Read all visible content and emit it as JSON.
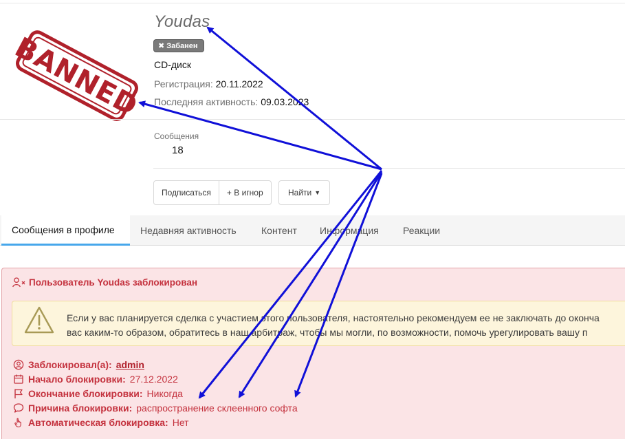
{
  "profile": {
    "username": "Youdas",
    "badge": "Забанен",
    "user_title": "CD-диск",
    "registration_label": "Регистрация:",
    "registration_value": "20.11.2022",
    "last_activity_label": "Последняя активность:",
    "last_activity_value": "09.03.2023",
    "stamp_text": "BANNED"
  },
  "stats": {
    "messages_label": "Сообщения",
    "messages_value": "18"
  },
  "actions": {
    "follow": "Подписаться",
    "ignore": "+ В игнор",
    "find": "Найти"
  },
  "tabs": [
    {
      "label": "Сообщения в профиле",
      "active": true
    },
    {
      "label": "Недавняя активность",
      "active": false
    },
    {
      "label": "Контент",
      "active": false
    },
    {
      "label": "Информация",
      "active": false
    },
    {
      "label": "Реакции",
      "active": false
    }
  ],
  "ban_notice": {
    "title": "Пользователь Youdas заблокирован",
    "warning_line1": "Если у вас планируется сделка с участием этого пользователя, настоятельно рекомендуем ее не заключать до оконча",
    "warning_line2": "вас каким-то образом, обратитесь в наш арбитраж, чтобы мы могли, по возможности, помочь урегулировать вашу п",
    "banned_by_label": "Заблокировал(а):",
    "banned_by_value": "admin",
    "start_label": "Начало блокировки:",
    "start_value": "27.12.2022",
    "end_label": "Окончание блокировки:",
    "end_value": "Никогда",
    "reason_label": "Причина блокировки:",
    "reason_value": "распространение склеенного софта",
    "auto_label": "Автоматическая блокировка:",
    "auto_value": "Нет"
  },
  "colors": {
    "tab_accent": "#47a7eb",
    "ban_red": "#c4323e",
    "ban_bg": "#fbe4e6",
    "warn_bg": "#fdf5dc",
    "arrow_blue": "#1010d8",
    "stamp_red": "#b0212b"
  }
}
